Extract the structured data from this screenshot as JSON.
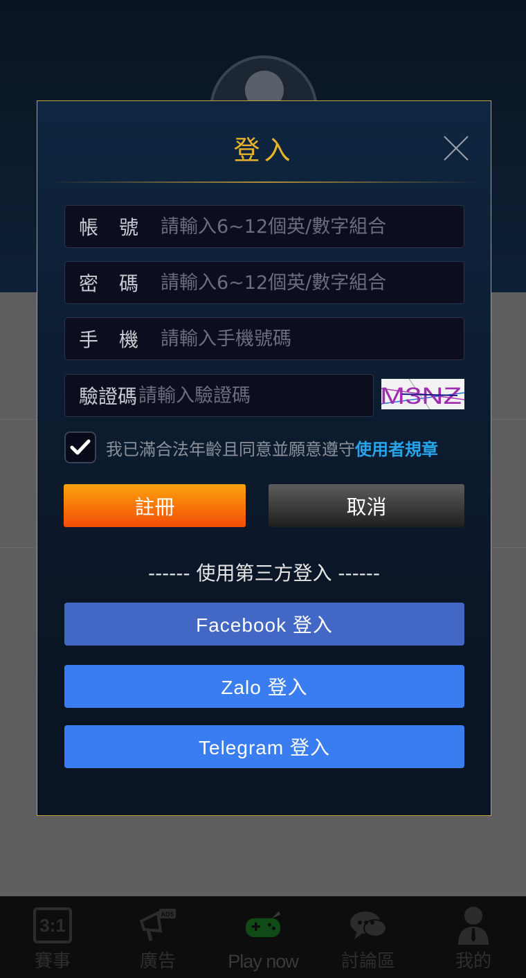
{
  "modal": {
    "title": "登入",
    "fields": [
      {
        "label": "帳號",
        "placeholder": "請輸入6~12個英/數字組合",
        "value": ""
      },
      {
        "label": "密碼",
        "placeholder": "請輸入6~12個英/數字組合",
        "value": ""
      },
      {
        "label": "手機",
        "placeholder": "請輸入手機號碼",
        "value": ""
      },
      {
        "label": "驗證碼",
        "placeholder": "請輸入驗證碼",
        "value": ""
      }
    ],
    "captcha_text": "M3NZ",
    "agree_text": "我已滿合法年齡且同意並願意遵守",
    "agree_link": "使用者規章",
    "agree_checked": true,
    "register_label": "註冊",
    "cancel_label": "取消",
    "third_party_label": "------ 使用第三方登入 ------",
    "social": {
      "facebook": "Facebook 登入",
      "zalo": "Zalo 登入",
      "telegram": "Telegram 登入"
    }
  },
  "bottom_nav": [
    {
      "label": "賽事",
      "icon": "calendar-score-icon",
      "badge": "3:1"
    },
    {
      "label": "廣告",
      "icon": "ads-megaphone-icon",
      "badge": "ADS"
    },
    {
      "label": "Play now",
      "icon": "gamepad-icon"
    },
    {
      "label": "討論區",
      "icon": "chat-bubbles-icon"
    },
    {
      "label": "我的",
      "icon": "user-profile-icon"
    }
  ],
  "colors": {
    "accent_gold": "#e8b22a",
    "link_blue": "#27a4ea",
    "register_orange": "#f24d07",
    "facebook_blue": "#4267c4",
    "zalo_blue": "#3a7df0"
  }
}
